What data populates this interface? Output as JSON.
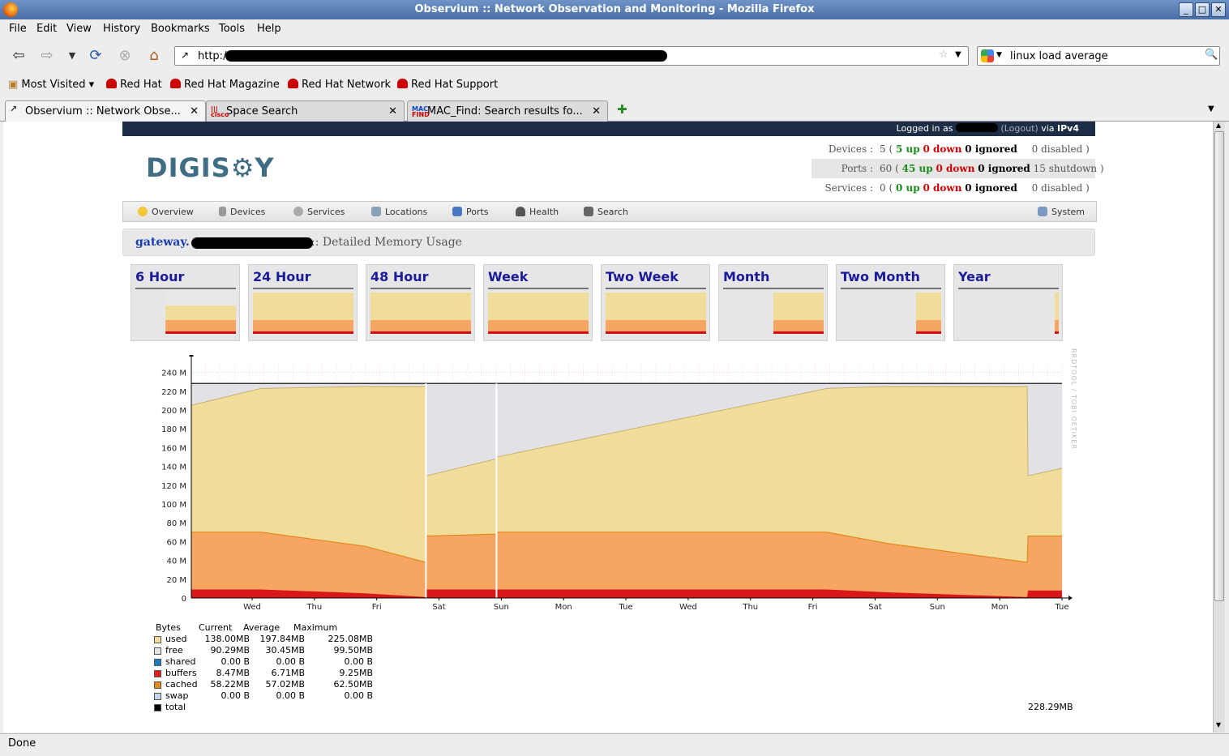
{
  "window": {
    "title": "Observium :: Network Observation and Monitoring - Mozilla Firefox",
    "buttons": [
      "_",
      "□",
      "✕"
    ]
  },
  "menu": [
    "File",
    "Edit",
    "View",
    "History",
    "Bookmarks",
    "Tools",
    "Help"
  ],
  "address": {
    "value": "http://"
  },
  "search": {
    "value": "linux load average"
  },
  "bookmarks": [
    "Most Visited",
    "Red Hat",
    "Red Hat Magazine",
    "Red Hat Network",
    "Red Hat Support"
  ],
  "tabs": [
    {
      "label": "Observium :: Network Obse...",
      "active": true
    },
    {
      "label": "Space Search",
      "active": false
    },
    {
      "label": "MAC_Find: Search results fo...",
      "active": false
    }
  ],
  "status": "Done",
  "header": {
    "logged_in_prefix": "Logged in as",
    "logout": "(Logout)",
    "via": "via",
    "ip": "IPv4",
    "logo": "DIGIS⚙Y"
  },
  "stats": {
    "devices": {
      "label": "Devices :",
      "total": "5",
      "open": "(",
      "up": "5 up",
      "down": "0 down",
      "ignored": "0 ignored",
      "tail": "0 disabled )"
    },
    "ports": {
      "label": "Ports :",
      "total": "60",
      "open": "(",
      "up": "45 up",
      "down": "0 down",
      "ignored": "0 ignored",
      "tail": "15 shutdown )"
    },
    "services": {
      "label": "Services :",
      "total": "0",
      "open": "(",
      "up": "0 up",
      "down": "0 down",
      "ignored": "0 ignored",
      "tail": "0 disabled )"
    }
  },
  "nav": [
    "Overview",
    "Devices",
    "Services",
    "Locations",
    "Ports",
    "Health",
    "Search",
    "System"
  ],
  "breadcrumb": {
    "device": "gateway.",
    "desc": ":: Detailed Memory Usage"
  },
  "periods": [
    "6 Hour",
    "24 Hour",
    "48 Hour",
    "Week",
    "Two Week",
    "Month",
    "Two Month",
    "Year"
  ],
  "legend": {
    "headers": [
      "Bytes",
      "Current",
      "Average",
      "Maximum"
    ],
    "rows": [
      {
        "name": "used",
        "color": "#f1dd9a",
        "current": "138.00MB",
        "average": "197.84MB",
        "maximum": "225.08MB"
      },
      {
        "name": "free",
        "color": "#e5e5e5",
        "current": "90.29MB",
        "average": "30.45MB",
        "maximum": "99.50MB"
      },
      {
        "name": "shared",
        "color": "#1b7bc4",
        "current": "0.00 B",
        "average": "0.00 B",
        "maximum": "0.00 B"
      },
      {
        "name": "buffers",
        "color": "#e02020",
        "current": "8.47MB",
        "average": "6.71MB",
        "maximum": "9.25MB"
      },
      {
        "name": "cached",
        "color": "#e38a1c",
        "current": "58.22MB",
        "average": "57.02MB",
        "maximum": "62.50MB"
      },
      {
        "name": "swap",
        "color": "#c5d6ef",
        "current": "0.00 B",
        "average": "0.00 B",
        "maximum": "0.00 B"
      },
      {
        "name": "total",
        "color": "#000000",
        "current": "",
        "average": "",
        "maximum": ""
      }
    ],
    "total_value": "228.29MB"
  },
  "watermark": "RRDTOOL / TOBI OETIKER",
  "chart_data": {
    "type": "area",
    "yticks": [
      "0",
      "20 M",
      "40 M",
      "60 M",
      "80 M",
      "100 M",
      "120 M",
      "140 M",
      "160 M",
      "180 M",
      "200 M",
      "220 M",
      "240 M"
    ],
    "ylim": [
      0,
      250
    ],
    "xticks": [
      "Wed",
      "Thu",
      "Fri",
      "Sat",
      "Sun",
      "Mon",
      "Tue",
      "Wed",
      "Thu",
      "Fri",
      "Sat",
      "Sun",
      "Mon",
      "Tue"
    ],
    "total_line": 228.29,
    "x": [
      0,
      0.08,
      0.2,
      0.269,
      0.27,
      0.35,
      0.351,
      0.73,
      0.8,
      0.96,
      0.961,
      1.0
    ],
    "series": [
      {
        "name": "used",
        "values": [
          205,
          223,
          225,
          225,
          130,
          148,
          150,
          223,
          225,
          225,
          130,
          138
        ]
      },
      {
        "name": "cached",
        "values": [
          70,
          70,
          55,
          38,
          66,
          68,
          70,
          70,
          58,
          38,
          66,
          66
        ]
      },
      {
        "name": "buffers",
        "values": [
          9,
          9,
          5,
          1,
          9,
          9,
          9,
          9,
          6,
          1,
          8,
          8
        ]
      }
    ]
  }
}
